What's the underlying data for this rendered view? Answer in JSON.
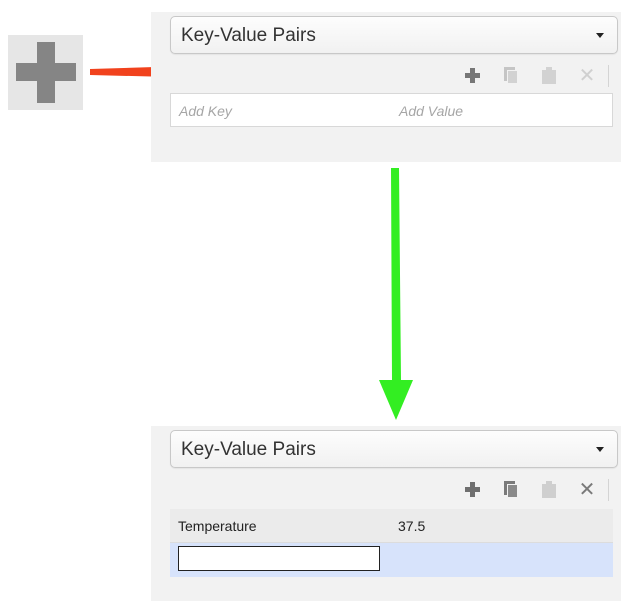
{
  "top_panel": {
    "dropdown": {
      "selected": "Key-Value Pairs"
    },
    "toolbar": {
      "add": "+",
      "copy": "copy",
      "paste": "paste",
      "delete": "✕"
    },
    "empty_row": {
      "key_placeholder": "Add Key",
      "value_placeholder": "Add Value"
    }
  },
  "bottom_panel": {
    "dropdown": {
      "selected": "Key-Value Pairs"
    },
    "toolbar": {
      "add": "+",
      "copy": "copy",
      "paste": "paste",
      "delete": "✕"
    },
    "rows": [
      {
        "key": "Temperature",
        "value": "37.5"
      }
    ],
    "edit_row": {
      "key_value": ""
    }
  },
  "icons": {
    "big_plus": "plus-icon",
    "toolbar": [
      "plus-icon",
      "copy-icon",
      "paste-icon",
      "delete-icon"
    ]
  },
  "colors": {
    "red_arrow": "#f1421d",
    "green_arrow": "#33ee22",
    "selected_row": "#d7e3fb",
    "panel_bg": "#f2f2f2"
  }
}
